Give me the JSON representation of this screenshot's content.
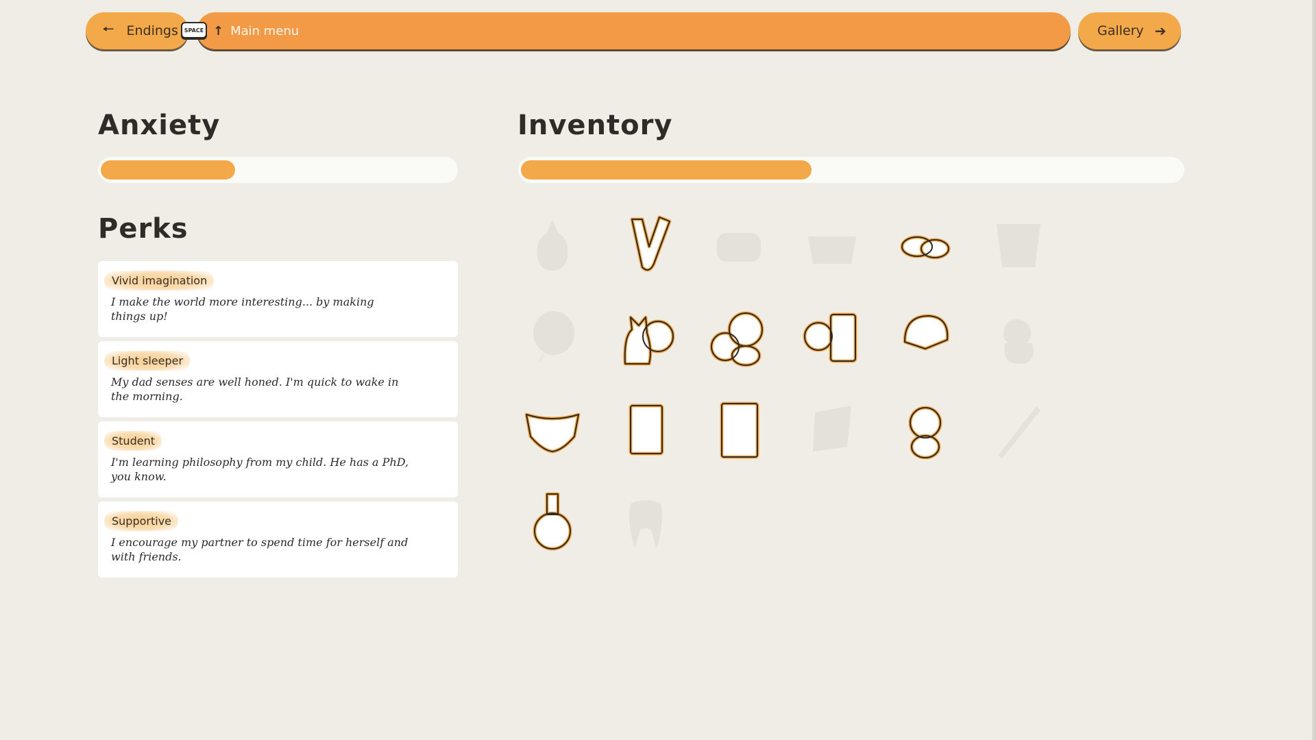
{
  "nav": {
    "left_label": "Endings",
    "left_arrow": "🠔",
    "center_label": "Main menu",
    "center_icon": "↑",
    "space_key": "SPACE",
    "right_label": "Gallery",
    "right_arrow": "➔"
  },
  "anxiety": {
    "title": "Anxiety",
    "level_fraction": 0.38
  },
  "inventory": {
    "title": "Inventory",
    "progress_fraction": 0.44,
    "items": [
      {
        "icon": "baby-bottle-icon",
        "owned": false
      },
      {
        "icon": "celery-icon",
        "owned": true
      },
      {
        "icon": "bread-icon",
        "owned": false
      },
      {
        "icon": "basket-icon",
        "owned": false
      },
      {
        "icon": "potatoes-icon",
        "owned": true
      },
      {
        "icon": "bucket-icon",
        "owned": false
      },
      {
        "icon": "balloon-icon",
        "owned": false
      },
      {
        "icon": "cat-with-ball-icon",
        "owned": true
      },
      {
        "icon": "baby-with-ball-icon",
        "owned": true
      },
      {
        "icon": "ball-and-book-icon",
        "owned": true
      },
      {
        "icon": "cap-icon",
        "owned": true
      },
      {
        "icon": "doll-icon",
        "owned": false
      },
      {
        "icon": "diaper-icon",
        "owned": true
      },
      {
        "icon": "document-icon",
        "owned": true
      },
      {
        "icon": "notepad-icon",
        "owned": true
      },
      {
        "icon": "paper-icon",
        "owned": false
      },
      {
        "icon": "baby-doll-icon",
        "owned": true
      },
      {
        "icon": "stick-icon",
        "owned": false
      },
      {
        "icon": "medal-icon",
        "owned": true
      },
      {
        "icon": "tooth-icon",
        "owned": false
      }
    ]
  },
  "perks": {
    "title": "Perks",
    "items": [
      {
        "name": "Vivid imagination",
        "description": "I make the world more interesting... by making things up!"
      },
      {
        "name": "Light sleeper",
        "description": "My dad senses are well honed. I'm quick to wake in the morning."
      },
      {
        "name": "Student",
        "description": "I'm learning philosophy from my child. He has a PhD, you know."
      },
      {
        "name": "Supportive",
        "description": "I encourage my partner to spend time for herself and with friends."
      }
    ]
  },
  "colors": {
    "accent": "#f3a849",
    "accent_dark": "#f29a45",
    "background": "#efede6",
    "ghost": "#e3e1da"
  }
}
